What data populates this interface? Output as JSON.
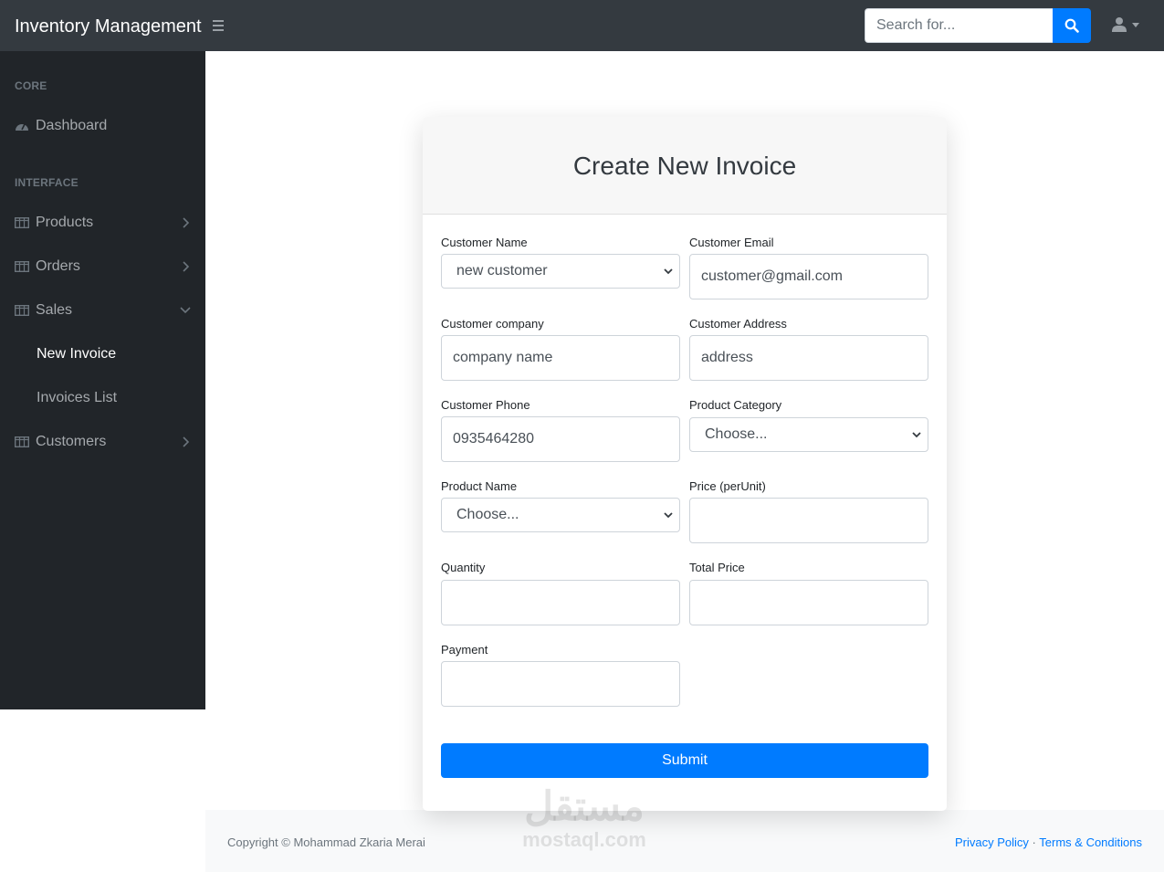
{
  "app": {
    "title": "Inventory Management"
  },
  "search": {
    "placeholder": "Search for..."
  },
  "icons": {
    "menu": "menu-icon",
    "search": "search-icon",
    "user": "user-icon",
    "dashboard": "tachometer-icon",
    "table": "table-icon"
  },
  "colors": {
    "navbar": "#343a40",
    "sidebar": "#212529",
    "primary": "#007bff",
    "footer": "#f8f9fa"
  },
  "sidebar": {
    "heading_core": "CORE",
    "heading_interface": "INTERFACE",
    "dashboard": "Dashboard",
    "products": "Products",
    "orders": "Orders",
    "sales": "Sales",
    "new_invoice": "New Invoice",
    "invoices_list": "Invoices List",
    "customers": "Customers"
  },
  "form": {
    "title": "Create New Invoice",
    "customer_name_label": "Customer Name",
    "customer_name_value": "new customer",
    "customer_email_label": "Customer Email",
    "customer_email_value": "customer@gmail.com",
    "customer_company_label": "Customer company",
    "customer_company_placeholder": "company name",
    "customer_address_label": "Customer Address",
    "customer_address_placeholder": "address",
    "customer_phone_label": "Customer Phone",
    "customer_phone_value": "0935464280",
    "product_category_label": "Product Category",
    "product_category_value": "Choose...",
    "product_name_label": "Product Name",
    "product_name_value": "Choose...",
    "price_label": "Price (perUnit)",
    "quantity_label": "Quantity",
    "total_price_label": "Total Price",
    "payment_label": "Payment",
    "submit_label": "Submit"
  },
  "footer": {
    "copyright": "Copyright © Mohammad Zkaria Merai",
    "privacy": "Privacy Policy",
    "separator": "·",
    "terms": "Terms & Conditions"
  },
  "watermark": {
    "arabic": "مستقل",
    "latin": "mostaql.com"
  }
}
